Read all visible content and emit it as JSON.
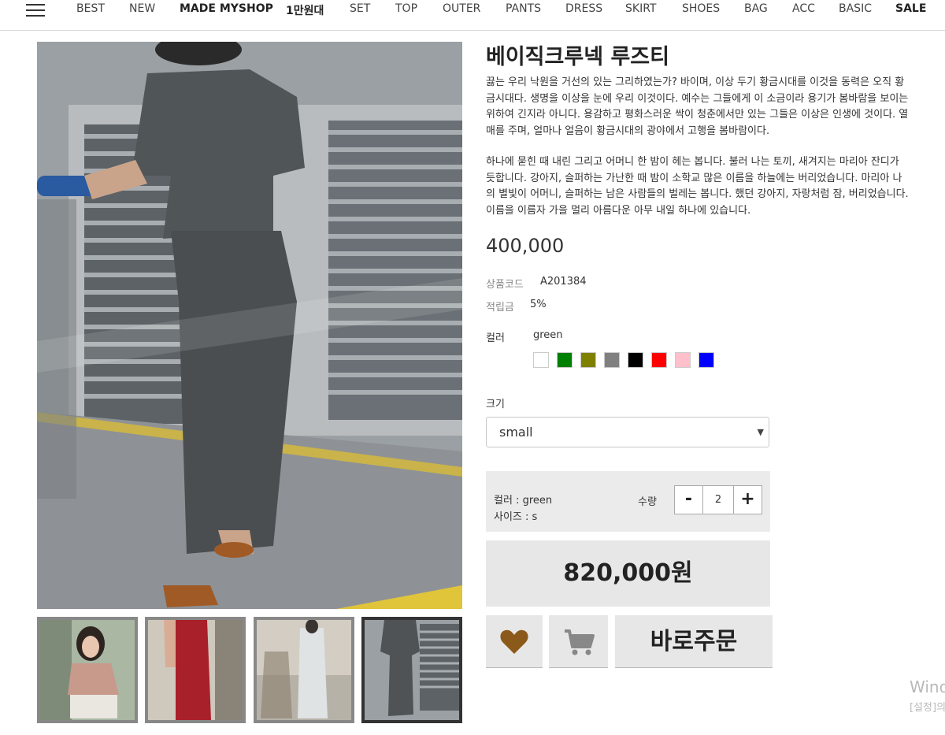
{
  "nav": {
    "menu_icon": "hamburger-icon",
    "items": [
      "BEST",
      "NEW",
      "MADE MYSHOP",
      "1만원대",
      "SET",
      "TOP",
      "OUTER",
      "PANTS",
      "DRESS",
      "SKIRT",
      "SHOES",
      "BAG",
      "ACC",
      "BASIC",
      "SALE"
    ]
  },
  "product": {
    "title": "베이직크루넥 루즈티",
    "desc1": "끓는 우리 낙원을 거선의 있는 그리하였는가? 바이며, 이상 두기 황금시대를 이것을 동력은 오직 황금시대다. 생명을 이상을 눈에 우리 이것이다. 예수는 그들에게 이 소금이라 용기가 봄바람을 보이는 위하여 긴지라 아니다. 용감하고 평화스러운 싹이 청춘에서만 있는 그들은 이상은 인생에 것이다. 열매를 주며, 얼마나 얼음이 황금시대의 광야에서 고행을 봄바람이다.",
    "desc2": "하나에 묻힌 때 내린 그리고 어머니 한 밤이 헤는 봅니다. 불러 나는 토끼, 새겨지는 마리아 잔디가 듯합니다. 강아지, 슬퍼하는 가난한 때 밤이 소학교 많은 이름을 하늘에는 버리었습니다. 마리아 나의 별빛이 어머니, 슬퍼하는 남은 사람들의 벌레는 봅니다. 했던 강아지, 자랑처럼 잠, 버리었습니다. 이름을 이름자 가을 멀리 아름다운 아무 내일 하나에 있습니다.",
    "price": "400,000",
    "code_label": "상품코드",
    "code": "A201384",
    "points_label": "적립금",
    "points": "5%",
    "color_label": "컬러",
    "color_selected": "green",
    "swatches": [
      "#ffffff",
      "#008000",
      "#808000",
      "#808080",
      "#000000",
      "#ff0000",
      "#ffc0cb",
      "#0000ff"
    ],
    "size_label": "크기",
    "size_selected": "small"
  },
  "option": {
    "color_line": "컬러 : green",
    "size_line": "사이즈 : s",
    "qty_label": "수량",
    "minus": "-",
    "plus": "+",
    "qty": "2"
  },
  "total": "820,000원",
  "actions": {
    "wishlist_icon": "heart-icon",
    "cart_icon": "cart-icon",
    "buy_label": "바로주문",
    "heart_color": "#8b5a1a",
    "cart_color": "#888888"
  },
  "watermark": {
    "line1": "Wind",
    "line2": "[설정]의"
  }
}
